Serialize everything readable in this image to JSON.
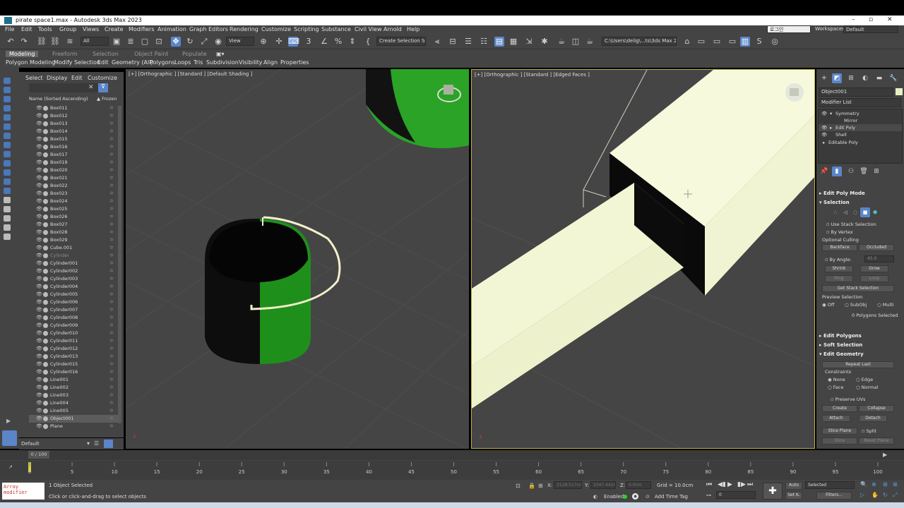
{
  "window": {
    "title": "pirate space1.max - Autodesk 3ds Max 2023"
  },
  "menu": [
    "File",
    "Edit",
    "Tools",
    "Group",
    "Views",
    "Create",
    "Modifiers",
    "Animation",
    "Graph Editors",
    "Rendering",
    "Customize",
    "Scripting",
    "Substance",
    "Civil View",
    "Arnold",
    "Help"
  ],
  "menu_right": {
    "lang_field": "로그인",
    "workspace_label": "Workspaces:",
    "workspace_value": "Default"
  },
  "toolbar": {
    "filter": "All",
    "refcoord": "View",
    "selection_set": "Create Selection Set",
    "path": "C:\\Users\\delig\\...ts\\3ds Max 202"
  },
  "ribbon": {
    "tabs": [
      "Modeling",
      "Freeform",
      "Selection",
      "Object Paint",
      "Populate"
    ],
    "items": [
      "Polygon Modeling",
      "Modify Selection",
      "Edit",
      "Geometry (All)",
      "Polygons",
      "Loops",
      "Tris",
      "Subdivision",
      "Visibility",
      "Align",
      "Properties"
    ]
  },
  "scene_explorer": {
    "tabs": [
      "Select",
      "Display",
      "Edit",
      "Customize"
    ],
    "col_name": "Name (Sorted Ascending)",
    "col_frozen": "▲ Frozen",
    "objects": [
      "Box011",
      "Box012",
      "Box013",
      "Box014",
      "Box015",
      "Box016",
      "Box017",
      "Box019",
      "Box020",
      "Box021",
      "Box022",
      "Box023",
      "Box024",
      "Box025",
      "Box026",
      "Box027",
      "Box028",
      "Box029",
      "Cube.001",
      "Cylinder",
      "Cylinder001",
      "Cylinder002",
      "Cylinder003",
      "Cylinder004",
      "Cylinder005",
      "Cylinder006",
      "Cylinder007",
      "Cylinder008",
      "Cylinder009",
      "Cylinder010",
      "Cylinder011",
      "Cylinder012",
      "Cylinder013",
      "Cylinder015",
      "Cylinder016",
      "Line001",
      "Line002",
      "Line003",
      "Line004",
      "Line005",
      "Object001",
      "Plane"
    ],
    "layer": "Default"
  },
  "viewports": {
    "left": "[+] [Orthographic ] [Standard ] [Default Shading ]",
    "right": "[+] [Orthographic ] [Standard ] [Edged Faces ]"
  },
  "command_panel": {
    "object_name": "Object001",
    "modifier_list": "Modifier List",
    "stack": [
      "Symmetry",
      "Mirror",
      "Edit Poly",
      "Shell",
      "Editable Poly"
    ],
    "edit_poly_mode": "Edit Poly Mode",
    "selection": "Selection",
    "use_stack": "Use Stack Selection",
    "by_vertex": "By Vertex",
    "optional_culling": "Optional Culling",
    "backface": "Backface",
    "occluded": "Occluded",
    "by_angle": "By Angle:",
    "angle_value": "45.0",
    "shrink": "Shrink",
    "grow": "Grow",
    "ring": "Ring",
    "loop": "Loop",
    "get_stack": "Get Stack Selection",
    "preview_selection": "Preview Selection",
    "preview_opts": [
      "Off",
      "SubObj",
      "Multi"
    ],
    "polys_selected": "0 Polygons Selected",
    "edit_polygons": "Edit Polygons",
    "soft_selection": "Soft Selection",
    "edit_geometry": "Edit Geometry",
    "repeat_last": "Repeat Last",
    "constraints": "Constraints",
    "constraint_opts": [
      "None",
      "Edge",
      "Face",
      "Normal"
    ],
    "preserve_uvs": "Preserve UVs",
    "create": "Create",
    "collapse": "Collapse",
    "attach": "Attach",
    "detach": "Detach",
    "slice_plane": "Slice Plane",
    "split": "Split",
    "slice": "Slice",
    "reset_plane": "Reset Plane"
  },
  "timeline": {
    "frame": "0 / 100",
    "ticks": [
      "0",
      "5",
      "10",
      "15",
      "20",
      "25",
      "30",
      "35",
      "40",
      "45",
      "50",
      "55",
      "60",
      "65",
      "70",
      "75",
      "80",
      "85",
      "90",
      "95",
      "100"
    ]
  },
  "status": {
    "maxscript": "Array modifier",
    "selected": "1 Object Selected",
    "prompt": "Click or click-and-drag to select objects",
    "x_label": "X:",
    "x_value": "2128.517cn",
    "y_label": "Y:",
    "y_value": "1047.442cn",
    "z_label": "Z:",
    "z_value": "0.0cm",
    "grid": "Grid = 10.0cm",
    "enabled": "Enabled:",
    "add_time_tag": "Add Time Tag",
    "auto": "Auto",
    "setk": "Set K.",
    "selected_dd": "Selected",
    "filters": "Filters...",
    "frame_field": "0"
  }
}
